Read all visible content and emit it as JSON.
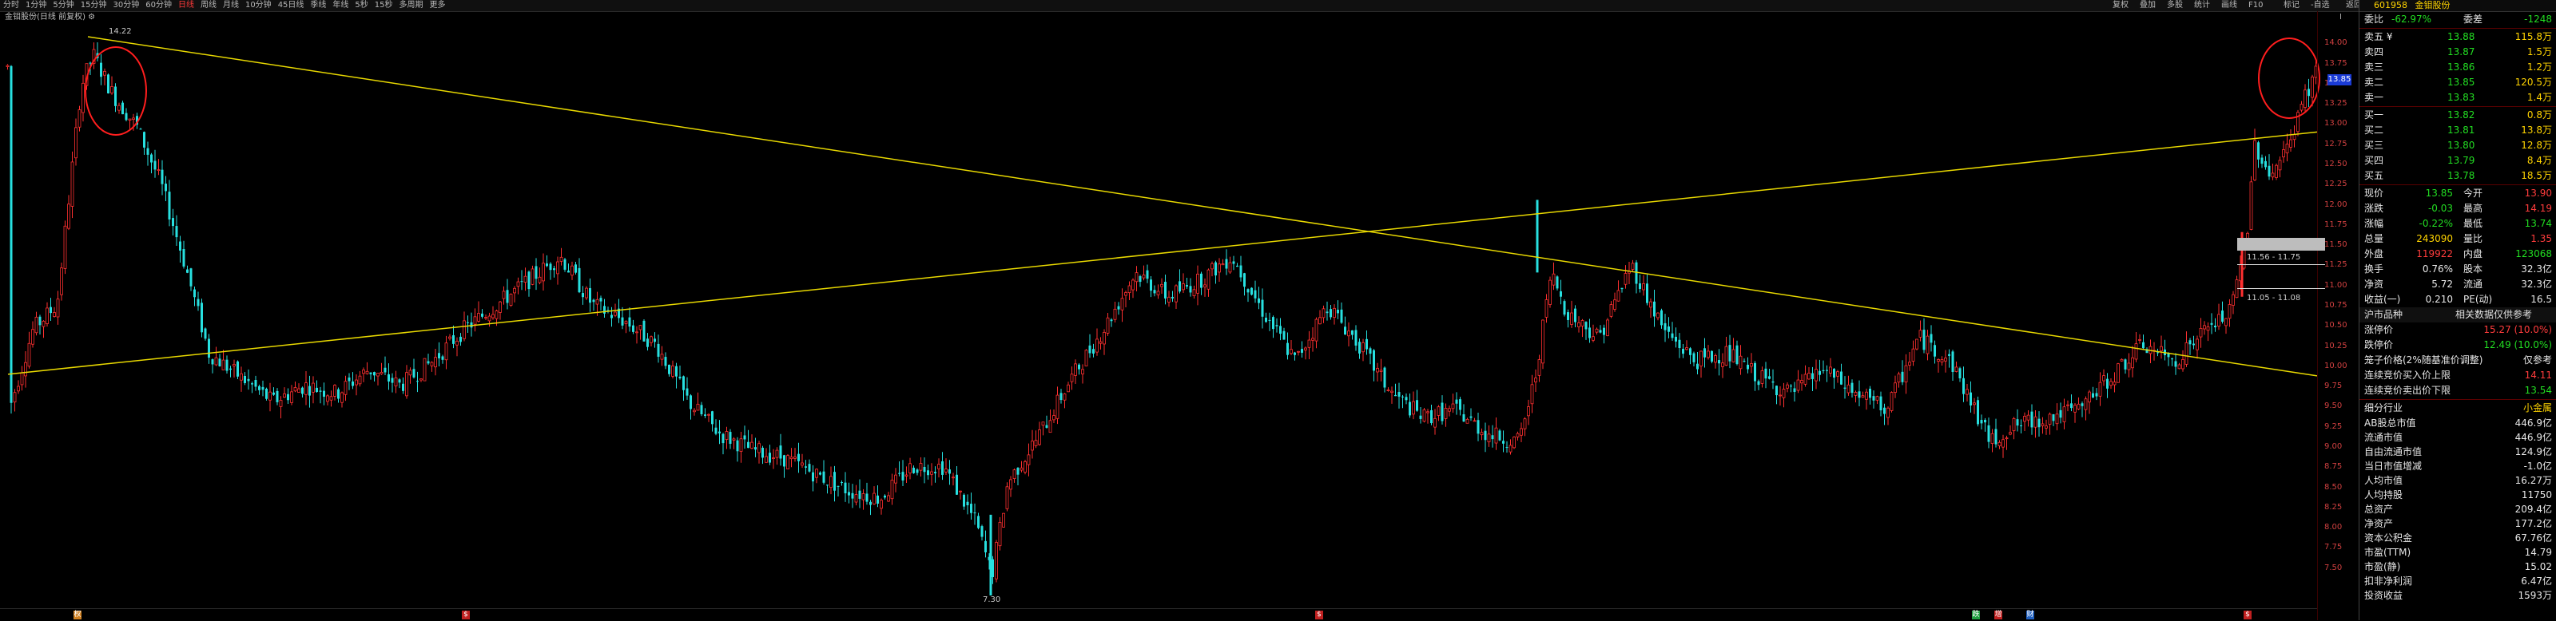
{
  "toolbar": {
    "timeframes": [
      "分时",
      "1分钟",
      "5分钟",
      "15分钟",
      "30分钟",
      "60分钟",
      "日线",
      "周线",
      "月线",
      "10分钟",
      "45日线",
      "季线",
      "年线",
      "5秒",
      "15秒",
      "多周期",
      "更多"
    ],
    "active": "日线",
    "right_items": [
      "复权",
      "叠加",
      "多股",
      "统计",
      "画线",
      "F10",
      "标记",
      "-自选",
      "返回"
    ]
  },
  "title_line": "金钼股份(日线 前复权) ⚙",
  "chart": {
    "high_label": "14.22",
    "low_label": "7.30",
    "range_label_1": "11.56 - 11.75",
    "range_label_2": "11.05 - 11.08",
    "current_price_tag": "13.85",
    "axis_button": "Ⅰ",
    "yaxis_ticks": [
      "14.00",
      "13.75",
      "13.50",
      "13.25",
      "13.00",
      "12.75",
      "12.50",
      "12.25",
      "12.00",
      "11.75",
      "11.50",
      "11.25",
      "11.00",
      "10.75",
      "10.50",
      "10.25",
      "10.00",
      "9.75",
      "9.50",
      "9.25",
      "9.00",
      "8.75",
      "8.50",
      "8.25",
      "8.00",
      "7.75",
      "7.50"
    ],
    "bottom_events": [
      {
        "text": "权",
        "color": "#d08020"
      },
      {
        "text": "$",
        "color": "#c02020"
      },
      {
        "text": "$",
        "color": "#c02020"
      },
      {
        "text": "跌",
        "color": "#20a040"
      },
      {
        "text": "增",
        "color": "#c02020"
      },
      {
        "text": "财",
        "color": "#2060c0"
      },
      {
        "text": "$",
        "color": "#c02020"
      }
    ],
    "colors": {
      "up": "#ff3030",
      "down": "#27e0e0",
      "trend": "#e8d800",
      "circle": "#ff1e1e"
    }
  },
  "chart_data": {
    "type": "candlestick",
    "title": "金钼股份(日线 前复权)",
    "ylim": [
      7.3,
      14.22
    ],
    "annotated_high": 14.22,
    "annotated_low": 7.3,
    "last_close": 13.85
  },
  "panel": {
    "code": "601958",
    "name": "金钼股份",
    "weibi_label": "委比",
    "weibi_value": "-62.97%",
    "weicha_label": "委差",
    "weicha_value": "-1248",
    "asks": [
      {
        "label": "卖五 ¥",
        "price": "13.88",
        "vol": "115.8万"
      },
      {
        "label": "卖四",
        "price": "13.87",
        "vol": "1.5万"
      },
      {
        "label": "卖三",
        "price": "13.86",
        "vol": "1.2万"
      },
      {
        "label": "卖二",
        "price": "13.85",
        "vol": "120.5万"
      },
      {
        "label": "卖一",
        "price": "13.83",
        "vol": "1.4万"
      }
    ],
    "bids": [
      {
        "label": "买一",
        "price": "13.82",
        "vol": "0.8万"
      },
      {
        "label": "买二",
        "price": "13.81",
        "vol": "13.8万"
      },
      {
        "label": "买三",
        "price": "13.80",
        "vol": "12.8万"
      },
      {
        "label": "买四",
        "price": "13.79",
        "vol": "8.4万"
      },
      {
        "label": "买五",
        "price": "13.78",
        "vol": "18.5万"
      }
    ],
    "quote": [
      {
        "l1": "现价",
        "v1": "13.85",
        "c1": "green",
        "l2": "今开",
        "v2": "13.90",
        "c2": "red"
      },
      {
        "l1": "涨跌",
        "v1": "-0.03",
        "c1": "green",
        "l2": "最高",
        "v2": "14.19",
        "c2": "red"
      },
      {
        "l1": "涨幅",
        "v1": "-0.22%",
        "c1": "green",
        "l2": "最低",
        "v2": "13.74",
        "c2": "green"
      },
      {
        "l1": "总量",
        "v1": "243090",
        "c1": "yellow",
        "l2": "量比",
        "v2": "1.35",
        "c2": "red"
      },
      {
        "l1": "外盘",
        "v1": "119922",
        "c1": "red",
        "l2": "内盘",
        "v2": "123068",
        "c2": "green"
      },
      {
        "l1": "换手",
        "v1": "0.76%",
        "c1": "white",
        "l2": "股本",
        "v2": "32.3亿",
        "c2": "white"
      },
      {
        "l1": "净资",
        "v1": "5.72",
        "c1": "white",
        "l2": "流通",
        "v2": "32.3亿",
        "c2": "white"
      },
      {
        "l1": "收益(一)",
        "v1": "0.210",
        "c1": "white",
        "l2": "PE(动)",
        "v2": "16.5",
        "c2": "white"
      }
    ],
    "ref_head_left": "沪市品种",
    "ref_head_right": "相关数据仅供参考",
    "ref_rows": [
      {
        "l": "涨停价",
        "v": "15.27 (10.0%)",
        "c": "red"
      },
      {
        "l": "跌停价",
        "v": "12.49 (10.0%)",
        "c": "green"
      },
      {
        "l": "笼子价格(2%随基准价调整)",
        "v": "仅参考",
        "c": "white"
      },
      {
        "l": "连续竞价买入价上限",
        "v": "14.11",
        "c": "red"
      },
      {
        "l": "连续竞价卖出价下限",
        "v": "13.54",
        "c": "green"
      }
    ],
    "industry_label": "细分行业",
    "industry_value": "小金属",
    "fin_rows": [
      {
        "l": "AB股总市值",
        "v": "446.9亿"
      },
      {
        "l": "流通市值",
        "v": "446.9亿"
      },
      {
        "l": "自由流通市值",
        "v": "124.9亿"
      },
      {
        "l": "当日市值增减",
        "v": "-1.0亿"
      },
      {
        "l": "人均市值",
        "v": "16.27万"
      },
      {
        "l": "人均持股",
        "v": "11750"
      },
      {
        "l": "总资产",
        "v": "209.4亿"
      },
      {
        "l": "净资产",
        "v": "177.2亿"
      },
      {
        "l": "资本公积金",
        "v": "67.76亿"
      },
      {
        "l": "市盈(TTM)",
        "v": "14.79"
      },
      {
        "l": "市盈(静)",
        "v": "15.02"
      },
      {
        "l": "扣非净利润",
        "v": "6.47亿"
      },
      {
        "l": "投资收益",
        "v": "1593万"
      }
    ]
  }
}
